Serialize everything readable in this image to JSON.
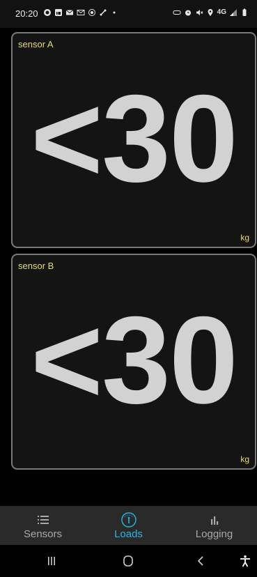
{
  "status_bar": {
    "time": "20:20",
    "left_icons": [
      "whatsapp-icon",
      "linkedin-icon",
      "mail-icon",
      "gmail-icon",
      "record-icon",
      "link-icon",
      "dot-icon"
    ],
    "right_icons": [
      "vr-icon",
      "alarm-icon",
      "mute-icon",
      "location-icon",
      "network-icon",
      "signal-icon",
      "battery-icon"
    ],
    "network_label": "4G"
  },
  "sensors": [
    {
      "name": "sensor A",
      "value": "<30",
      "unit": "kg"
    },
    {
      "name": "sensor B",
      "value": "<30",
      "unit": "kg"
    }
  ],
  "bottom_nav": {
    "items": [
      {
        "label": "Sensors",
        "icon": "list-icon",
        "active": false
      },
      {
        "label": "Loads",
        "icon": "gauge-icon",
        "active": true
      },
      {
        "label": "Logging",
        "icon": "bar-chart-icon",
        "active": false
      }
    ]
  },
  "system_nav": [
    "recents-icon",
    "home-icon",
    "back-icon",
    "accessibility-icon"
  ],
  "colors": {
    "accent": "#2bb5e6",
    "label_yellow": "#e6dc6a",
    "value_gray": "#d2d2d2",
    "card_bg": "#141414",
    "card_border": "#7a7a7a",
    "nav_bg": "#2a2a2a"
  }
}
